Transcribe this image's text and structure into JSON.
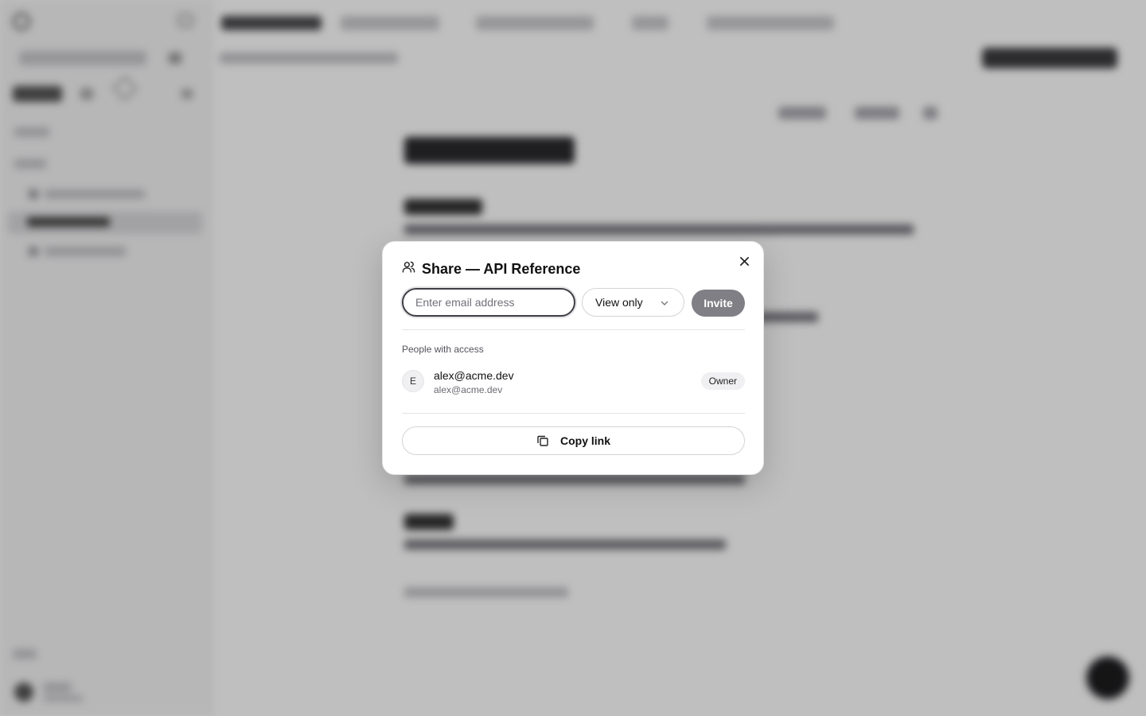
{
  "modal": {
    "title": "Share — API Reference",
    "email_placeholder": "Enter email address",
    "permission_selected": "View only",
    "invite_label": "Invite",
    "section_label": "People with access",
    "people": [
      {
        "initial": "E",
        "name": "alex@acme.dev",
        "email": "alex@acme.dev",
        "role": "Owner"
      }
    ],
    "copy_link_label": "Copy link"
  },
  "icons": {
    "title_icon": "users-icon",
    "close_icon": "close-icon",
    "dropdown_icon": "chevron-down-icon",
    "copy_icon": "copy-icon"
  },
  "colors": {
    "invite_button": "#7f7f85",
    "overlay": "rgba(0,0,0,0.25)"
  }
}
